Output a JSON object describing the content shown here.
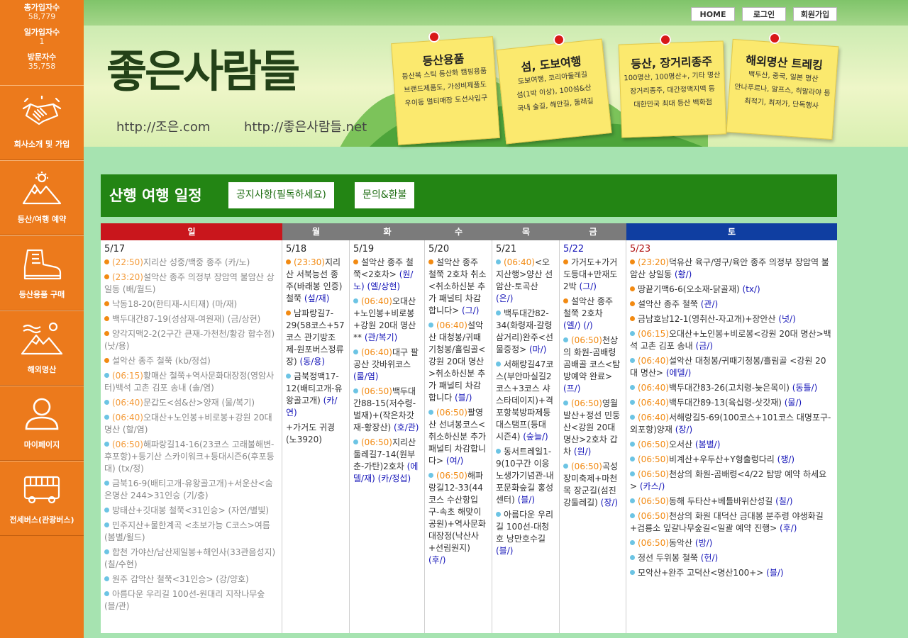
{
  "stats": [
    {
      "label": "총가입자수",
      "value": "58,779"
    },
    {
      "label": "일가입자수",
      "value": "1"
    },
    {
      "label": "방문자수",
      "value": "35,758"
    }
  ],
  "menu": [
    {
      "label": "회사소개 및 가입",
      "icon": "handshake-icon"
    },
    {
      "label": "등산/여행 예약",
      "icon": "mountain-sun-icon"
    },
    {
      "label": "등산용품 구매",
      "icon": "hiking-boot-icon"
    },
    {
      "label": "해외명산",
      "icon": "snow-mountain-icon"
    },
    {
      "label": "마이페이지",
      "icon": "user-icon"
    },
    {
      "label": "전세버스(관광버스)",
      "icon": "bus-icon"
    }
  ],
  "top_buttons": [
    "HOME",
    "로그인",
    "회원가입"
  ],
  "logo_text": "좋은사람들",
  "urls": [
    "http://조은.com",
    "http://좋은사람들.net"
  ],
  "notes": [
    {
      "title": "등산용품",
      "lines": [
        "등산복 스틱 등산화 캠핑용품",
        "브랜드제품도, 가성비제품도",
        "우이동 멀티매장 도선사입구"
      ]
    },
    {
      "title": "섬, 도보여행",
      "lines": [
        "도보여행, 코리아둘레길",
        "섬(1박 이상), 100섬&산",
        "국내 숲길, 해안길, 둘레길"
      ]
    },
    {
      "title": "등산, 장거리종주",
      "lines": [
        "100명산, 100명산+, 기타 명산",
        "장거리종주, 대간정맥지맥 등",
        "대한민국 최대 등산 백화점"
      ]
    },
    {
      "title": "해외명산 트레킹",
      "lines": [
        "백두산, 중국, 일본 명산",
        "안나푸르나, 알프스, 히말라야 등",
        "최적기, 최저가, 단독행사"
      ]
    }
  ],
  "section_title": "산행 여행 일정",
  "notice_button": "공지사항(필독하세요)",
  "inquiry_button": "문의&환불",
  "days": [
    {
      "label": "일",
      "color": "#c9161c"
    },
    {
      "label": "월",
      "color": "#7b7b7b"
    },
    {
      "label": "화",
      "color": "#7b7b7b"
    },
    {
      "label": "수",
      "color": "#7b7b7b"
    },
    {
      "label": "목",
      "color": "#7b7b7b"
    },
    {
      "label": "금",
      "color": "#7b7b7b"
    },
    {
      "label": "토",
      "color": "#0f3ea1"
    }
  ],
  "columns": [
    {
      "date": "5/17",
      "events": [
        {
          "dot": "#f28a12",
          "time": "(22:50)",
          "text": "지리산 성중/백중 종주 ",
          "tag": "(카/노)",
          "past": true
        },
        {
          "dot": "#f28a12",
          "time": "(23:20)",
          "text": "설악산 종주 의정부 장암역 불암산 상일동 ",
          "tag": "(배/월드)",
          "past": true
        },
        {
          "dot": "#f28a12",
          "time": "",
          "text": "낙동18-20(한티재-시티재) ",
          "tag": "(마/재)",
          "past": true
        },
        {
          "dot": "#f28a12",
          "time": "",
          "text": "백두대간87-19(성삼재-여원재) ",
          "tag": "(금/상현)",
          "past": true
        },
        {
          "dot": "#f28a12",
          "time": "",
          "text": "양각지맥2-2(2구간 큰재-가천천/황강 합수점) ",
          "tag": "(낫/용)",
          "past": true
        },
        {
          "dot": "#f28a12",
          "time": "",
          "text": "설악산 종주 철쭉 ",
          "tag": "(kb/정섭)",
          "past": true
        },
        {
          "dot": "#6cc4e4",
          "time": "(06:15)",
          "text": "황매산 철쭉+역사문화대장정(영암사터)백석 고촌 김포 송내 ",
          "tag": "(솔/염)",
          "past": true
        },
        {
          "dot": "#6cc4e4",
          "time": "(06:40)",
          "text": "문갑도<섬&산>양재 ",
          "tag": "(물/복기)",
          "past": true
        },
        {
          "dot": "#6cc4e4",
          "time": "(06:40)",
          "text": "오대산+노인봉+비로봉+강원 20대 명산 ",
          "tag": "(할/염)",
          "past": true
        },
        {
          "dot": "#6cc4e4",
          "time": "(06:50)",
          "text": "해파랑길14-16(23코스 고래불해변-후포항)+등기산 스카이워크+등대시즌6(후포등대) ",
          "tag": "(tx/정)",
          "past": true
        },
        {
          "dot": "#6cc4e4",
          "time": "",
          "text": "금북16-9(배티고개-유왕골고개)+서운산<숨은명산 244>31인승 ",
          "tag": "(기/충)",
          "past": true
        },
        {
          "dot": "#6cc4e4",
          "time": "",
          "text": "방태산+깃대봉 철쭉<31인승> ",
          "tag": "(자연/별빛)",
          "past": true
        },
        {
          "dot": "#6cc4e4",
          "time": "",
          "text": "민주지산+물한계곡 <초보가능 C코스>여름 ",
          "tag": "(봄별/윌드)",
          "past": true
        },
        {
          "dot": "#6cc4e4",
          "time": "",
          "text": "합천 가야산/남산제일봉+해인사(33관음성지) ",
          "tag": "(칠/수현)",
          "past": true
        },
        {
          "dot": "#6cc4e4",
          "time": "",
          "text": "원주 감악산 철쭉<31인승> ",
          "tag": "(강/양호)",
          "past": true
        },
        {
          "dot": "#6cc4e4",
          "time": "",
          "text": "아름다운 우리길 100선-원대리 지작나무숲 ",
          "tag": "(블/관)",
          "past": true
        }
      ]
    },
    {
      "date": "5/18",
      "events": [
        {
          "dot": "#f28a12",
          "time": "(23:30)",
          "text": "지리산 서북능선 종주(바래봉 인증) 철쭉 ",
          "tag": "(섶/재)",
          "past": false
        },
        {
          "dot": "#f28a12",
          "time": "",
          "text": "남파랑길7-29(58코스+57코스 관기방조제-원포버스정류장) ",
          "tag": "(동/용)",
          "past": false
        },
        {
          "dot": "#6cc4e4",
          "time": "",
          "text": "금북정맥17-12(배티고개-유왕골고개) ",
          "tag": "(카/연)",
          "past": false
        },
        {
          "dot": "",
          "time": "",
          "text": "+가거도 귀경(노3920)",
          "tag": "",
          "past": false
        }
      ]
    },
    {
      "date": "5/19",
      "events": [
        {
          "dot": "#f28a12",
          "time": "",
          "text": "설악산 종주 철쭉<2호차> ",
          "tag": "(원/노) (엘/상현)",
          "past": false
        },
        {
          "dot": "#6cc4e4",
          "time": "(06:40)",
          "text": "오대산+노인봉+비로봉+강원 20대 명산 ** ",
          "tag": "(관/복기)",
          "past": false
        },
        {
          "dot": "#6cc4e4",
          "time": "(06:40)",
          "text": "대구 팔공산 갓바위코스 ",
          "tag": "(룰/염)",
          "past": false
        },
        {
          "dot": "#6cc4e4",
          "time": "(06:50)",
          "text": "백두대간88-15(저수령-벌재)+(작은차갓재-황장산) ",
          "tag": "(호/관)",
          "past": false
        },
        {
          "dot": "#6cc4e4",
          "time": "(06:50)",
          "text": "지리산 둘레길7-14(원부춘-가탄)2호차 ",
          "tag": "(에델/재) (카/정섭)",
          "past": false
        }
      ]
    },
    {
      "date": "5/20",
      "events": [
        {
          "dot": "#f28a12",
          "time": "",
          "text": "설악산 종주 철쭉 2호차 취소<취소하신분 추가 패널티 차감합니다> ",
          "tag": "(그/)",
          "past": false
        },
        {
          "dot": "#6cc4e4",
          "time": "(06:40)",
          "text": "설악산 대청봉/귀때기청봉/흘림골<강원 20대 명산>취소하신분 추가 패널티 차감합니다 ",
          "tag": "(블/)",
          "past": false
        },
        {
          "dot": "#6cc4e4",
          "time": "(06:50)",
          "text": "팔영산 선녀봉코스<취소하신분 추가 패널티 차감합니다> ",
          "tag": "(여/)",
          "past": false
        },
        {
          "dot": "#6cc4e4",
          "time": "(06:50)",
          "text": "해파랑길12-33(44코스 수산항입구-속초 해맞이공원)+역사문화대장정(낙산사+선림원지) ",
          "tag": "(후/)",
          "past": false
        }
      ]
    },
    {
      "date": "5/21",
      "events": [
        {
          "dot": "#6cc4e4",
          "time": "(06:40)",
          "text": "<오지산행>양산 선암산-토곡산 ",
          "tag": "(은/)",
          "past": false
        },
        {
          "dot": "#6cc4e4",
          "time": "",
          "text": "백두대간82-34(화령재-갈령삼거리)완주<선물증정> ",
          "tag": "(마/)",
          "past": false
        },
        {
          "dot": "#6cc4e4",
          "time": "",
          "text": "서해랑길47코스(부안마실길2코스+3코스 샤스타데이지)+격포항북방파제등대스탬프(등대 시즌4) ",
          "tag": "(숲늘/)",
          "past": false
        },
        {
          "dot": "#6cc4e4",
          "time": "",
          "text": "동서트레일1-9(10구간 이응노생가기념관-내포문화숲길 홍성센터) ",
          "tag": "(블/)",
          "past": false
        },
        {
          "dot": "#6cc4e4",
          "time": "",
          "text": "아름다운 우리길 100선-대청호 낭만호수길 ",
          "tag": "(블/)",
          "past": false
        }
      ]
    },
    {
      "date": "5/22",
      "events": [
        {
          "dot": "#f28a12",
          "time": "",
          "text": "가거도+가거도등대+만재도 2박 ",
          "tag": "(그/)",
          "past": false
        },
        {
          "dot": "#f28a12",
          "time": "",
          "text": "설악산 종주 철쭉 2호차 ",
          "tag": "(엘/) (/)",
          "past": false
        },
        {
          "dot": "#6cc4e4",
          "time": "(06:50)",
          "text": "천상의 화원-곰배령 곰배골 코스<탐방예약 완료> ",
          "tag": "(프/)",
          "past": false
        },
        {
          "dot": "#6cc4e4",
          "time": "(06:50)",
          "text": "영월 발산+정선 민둥산<강원 20대 명산>2호차 갑차 ",
          "tag": "(원/)",
          "past": false
        },
        {
          "dot": "#6cc4e4",
          "time": "(06:50)",
          "text": "곡성 장미축제+마천목 장군길(섬진강둘레길) ",
          "tag": "(장/)",
          "past": false
        }
      ]
    },
    {
      "date": "5/23",
      "events": [
        {
          "dot": "#f28a12",
          "time": "(23:20)",
          "text": "덕유산 육구/영구/육안 종주 의정부 장암역 불암산 상일동 ",
          "tag": "(황/)",
          "past": false
        },
        {
          "dot": "#f28a12",
          "time": "",
          "text": "땅끝기맥6-6(오소재-닭골재) ",
          "tag": "(tx/)",
          "past": false
        },
        {
          "dot": "#f28a12",
          "time": "",
          "text": "설악산 종주 철쭉 ",
          "tag": "(관/)",
          "past": false
        },
        {
          "dot": "#f28a12",
          "time": "",
          "text": "금남호남12-1(영취산-자고개)+장안산 ",
          "tag": "(넛/)",
          "past": false
        },
        {
          "dot": "#6cc4e4",
          "time": "(06:15)",
          "text": "오대산+노인봉+비로봉<강원 20대 명산>백석 고촌 김포 송내 ",
          "tag": "(금/)",
          "past": false
        },
        {
          "dot": "#6cc4e4",
          "time": "(06:40)",
          "text": "설악산 대청봉/귀때기청봉/흘림골 <강원 20대 명산> ",
          "tag": "(에델/)",
          "past": false
        },
        {
          "dot": "#6cc4e4",
          "time": "(06:40)",
          "text": "백두대간83-26(고치령-늦은목이) ",
          "tag": "(동틀/)",
          "past": false
        },
        {
          "dot": "#6cc4e4",
          "time": "(06:40)",
          "text": "백두대간89-13(육십령-삿갓재) ",
          "tag": "(물/)",
          "past": false
        },
        {
          "dot": "#6cc4e4",
          "time": "(06:40)",
          "text": "서해랑길5-69(100코스+101코스 대명포구-외포항)양재 ",
          "tag": "(장/)",
          "past": false
        },
        {
          "dot": "#6cc4e4",
          "time": "(06:50)",
          "text": "오서산 ",
          "tag": "(봄별/)",
          "past": false
        },
        {
          "dot": "#6cc4e4",
          "time": "(06:50)",
          "text": "비계산+우두산+Y형출렁다리 ",
          "tag": "(쟁/)",
          "past": false
        },
        {
          "dot": "#6cc4e4",
          "time": "(06:50)",
          "text": "천상의 화원-곰배령<4/22 탐방 예약 하세요> ",
          "tag": "(카스/)",
          "past": false
        },
        {
          "dot": "#6cc4e4",
          "time": "(06:50)",
          "text": "동해 두타산+베틀바위산성길 ",
          "tag": "(칠/)",
          "past": false
        },
        {
          "dot": "#6cc4e4",
          "time": "(06:50)",
          "text": "천상의 화원 대덕산 금대봉 분주령 야생화길+검룡소 잎갈나무숲길<일괄 예약 진행> ",
          "tag": "(후/)",
          "past": false
        },
        {
          "dot": "#6cc4e4",
          "time": "(06:50)",
          "text": "동악산 ",
          "tag": "(방/)",
          "past": false
        },
        {
          "dot": "#6cc4e4",
          "time": "",
          "text": "정선 두위봉 철쭉 ",
          "tag": "(헌/)",
          "past": false
        },
        {
          "dot": "#6cc4e4",
          "time": "",
          "text": "모악산+완주 고덕산<명산100+> ",
          "tag": "(블/)",
          "past": false
        }
      ]
    }
  ]
}
